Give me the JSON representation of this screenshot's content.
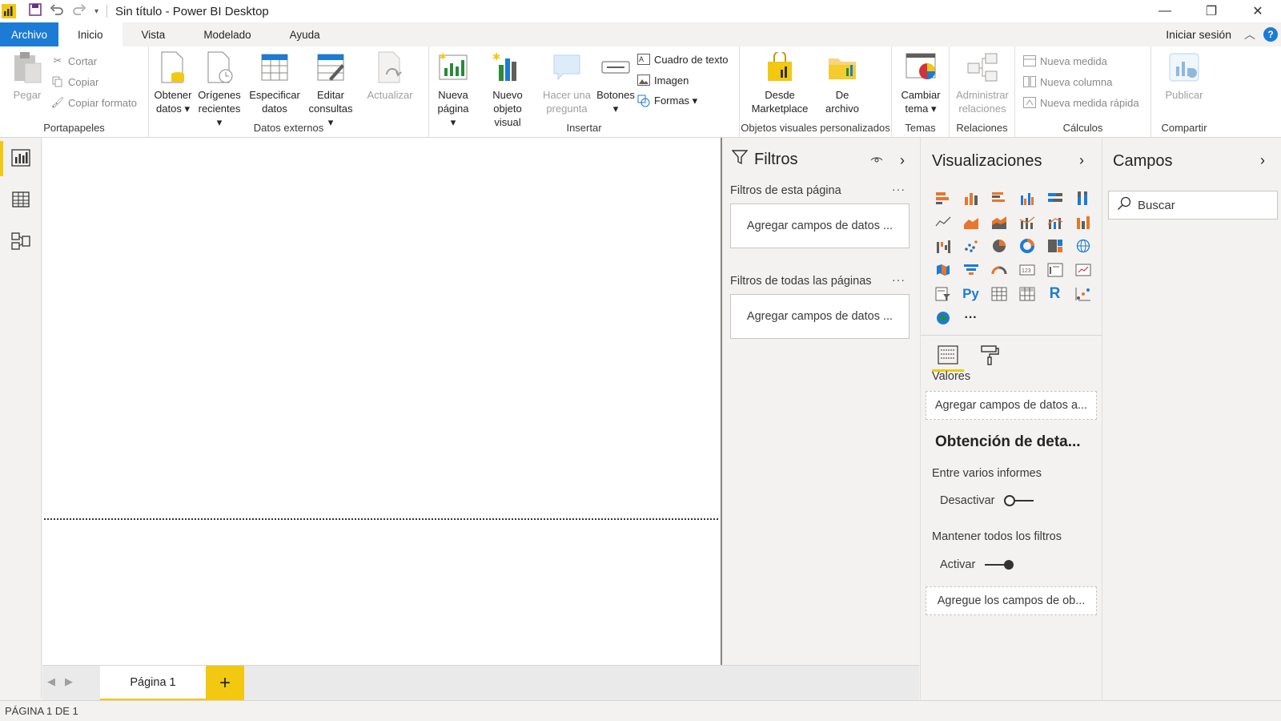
{
  "window": {
    "title": "Sin título - Power BI Desktop",
    "brand_color": "#f2c811",
    "accent_color": "#1c7bd4"
  },
  "ribbon_tabs": [
    {
      "label": "Archivo",
      "state": "file"
    },
    {
      "label": "Inicio",
      "state": "active"
    },
    {
      "label": "Vista",
      "state": "normal"
    },
    {
      "label": "Modelado",
      "state": "normal"
    },
    {
      "label": "Ayuda",
      "state": "normal"
    }
  ],
  "signin": "Iniciar sesión",
  "ribbon": {
    "clipboard": {
      "paste": "Pegar",
      "cut": "Cortar",
      "copy": "Copiar",
      "copy_format": "Copiar formato",
      "group": "Portapapeles"
    },
    "external": {
      "get_data_1": "Obtener",
      "get_data_2": "datos",
      "recent_1": "Orígenes",
      "recent_2": "recientes",
      "enter_1": "Especificar",
      "enter_2": "datos",
      "edit_1": "Editar",
      "edit_2": "consultas",
      "refresh": "Actualizar",
      "group": "Datos externos"
    },
    "insert": {
      "newpage_1": "Nueva",
      "newpage_2": "página",
      "newvisual_1": "Nuevo",
      "newvisual_2": "objeto visual",
      "ask_1": "Hacer una",
      "ask_2": "pregunta",
      "buttons": "Botones",
      "textbox": "Cuadro de texto",
      "image": "Imagen",
      "shapes": "Formas",
      "group": "Insertar"
    },
    "custom": {
      "market_1": "Desde",
      "market_2": "Marketplace",
      "file_1": "De",
      "file_2": "archivo",
      "group": "Objetos visuales personalizados"
    },
    "themes": {
      "switch_1": "Cambiar",
      "switch_2": "tema",
      "group": "Temas"
    },
    "relations": {
      "manage_1": "Administrar",
      "manage_2": "relaciones",
      "group": "Relaciones"
    },
    "calc": {
      "new_measure": "Nueva medida",
      "new_column": "Nueva columna",
      "quick_measure": "Nueva medida rápida",
      "group": "Cálculos"
    },
    "share": {
      "publish": "Publicar",
      "group": "Compartir"
    }
  },
  "filters": {
    "title": "Filtros",
    "this_page": "Filtros de esta página",
    "all_pages": "Filtros de todas las páginas",
    "add_fields": "Agregar campos de datos ...",
    "more": "···"
  },
  "visualizations": {
    "title": "Visualizaciones",
    "more": "···",
    "values_label": "Valores",
    "values_box": "Agregar campos de datos a...",
    "drill_title": "Obtención de deta...",
    "cross_report": "Entre varios informes",
    "cross_report_state": "Desactivar",
    "keep_filters": "Mantener todos los filtros",
    "keep_filters_state": "Activar",
    "drill_box": "Agregue los campos de ob..."
  },
  "fields": {
    "title": "Campos",
    "search_placeholder": "Buscar"
  },
  "page_tabs": {
    "current": "Página 1",
    "add": "+"
  },
  "status": "PÁGINA 1 DE 1"
}
